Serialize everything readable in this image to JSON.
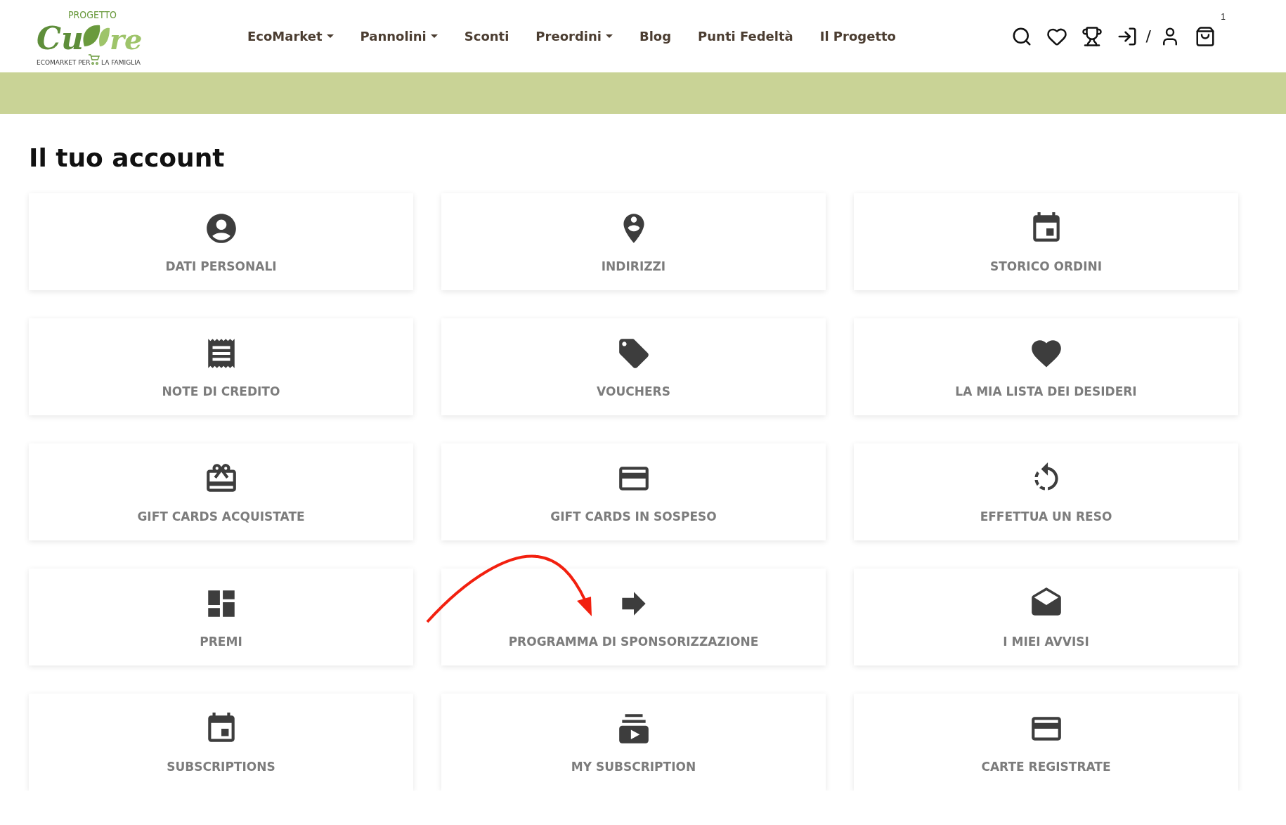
{
  "logo": {
    "top": "PROGETTO",
    "word_left": "Cu",
    "word_right": "re",
    "tagline_left": "ECOMARKET PER",
    "tagline_right": "LA FAMIGLIA"
  },
  "nav": [
    {
      "label": "EcoMarket",
      "dropdown": true
    },
    {
      "label": "Pannolini",
      "dropdown": true
    },
    {
      "label": "Sconti",
      "dropdown": false
    },
    {
      "label": "Preordini",
      "dropdown": true
    },
    {
      "label": "Blog",
      "dropdown": false
    },
    {
      "label": "Punti Fedeltà",
      "dropdown": false
    },
    {
      "label": "Il Progetto",
      "dropdown": false
    }
  ],
  "header_actions": {
    "separator": "/",
    "cart_count": "1"
  },
  "page_title": "Il tuo account",
  "cards": [
    {
      "kind": "account",
      "label": "DATI PERSONALI"
    },
    {
      "kind": "pin",
      "label": "INDIRIZZI"
    },
    {
      "kind": "calendar",
      "label": "STORICO ORDINI"
    },
    {
      "kind": "receipt",
      "label": "NOTE DI CREDITO"
    },
    {
      "kind": "tag",
      "label": "VOUCHERS"
    },
    {
      "kind": "heart",
      "label": "LA MIA LISTA DEI DESIDERI"
    },
    {
      "kind": "gift",
      "label": "GIFT CARDS ACQUISTATE"
    },
    {
      "kind": "card",
      "label": "GIFT CARDS IN SOSPESO"
    },
    {
      "kind": "return",
      "label": "EFFETTUA UN RESO"
    },
    {
      "kind": "dashboard",
      "label": "PREMI"
    },
    {
      "kind": "forward",
      "label": "PROGRAMMA DI SPONSORIZZAZIONE"
    },
    {
      "kind": "mail",
      "label": "I MIEI AVVISI"
    },
    {
      "kind": "calendar",
      "label": "SUBSCRIPTIONS"
    },
    {
      "kind": "subscriptions",
      "label": "MY SUBSCRIPTION"
    },
    {
      "kind": "card",
      "label": "CARTE REGISTRATE"
    }
  ]
}
